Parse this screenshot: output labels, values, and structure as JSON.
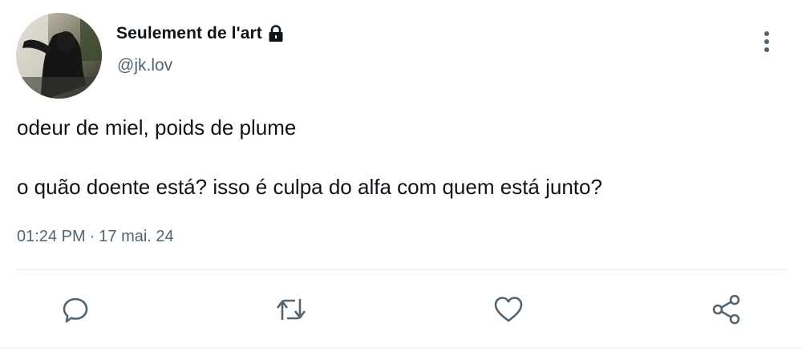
{
  "user": {
    "display_name": "Seulement de l'art",
    "handle": "@jk.lov",
    "protected_icon": "lock-icon",
    "avatar_icon": "avatar-photo"
  },
  "tweet": {
    "lines": [
      "odeur de miel, poids de plume",
      "o quão doente está? isso é culpa do alfa com quem está junto?"
    ],
    "time": "01:24 PM",
    "separator": "·",
    "date": "17 mai. 24"
  },
  "actions": [
    {
      "icon": "reply-icon"
    },
    {
      "icon": "retweet-icon"
    },
    {
      "icon": "like-icon"
    },
    {
      "icon": "share-icon"
    }
  ],
  "menu": {
    "icon": "more-options-icon"
  },
  "colors": {
    "text_primary": "#0f1419",
    "text_secondary": "#536471",
    "icon_gray": "#536471",
    "divider": "#e6e9eb",
    "background": "#ffffff"
  }
}
